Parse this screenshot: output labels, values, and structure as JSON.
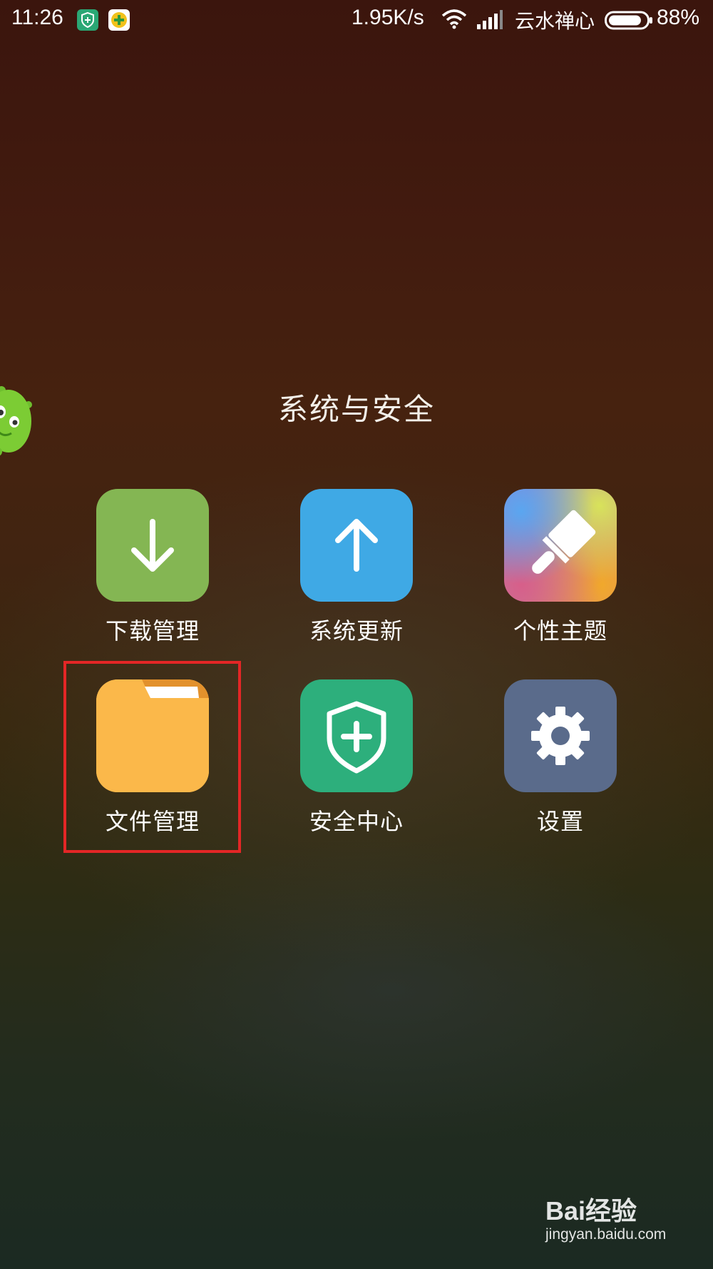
{
  "status_bar": {
    "time": "11:26",
    "notification_icons": [
      "shield-app-icon",
      "plus-app-icon"
    ],
    "network_speed": "1.95K/s",
    "carrier": "云水禅心",
    "battery_percent": "88%",
    "battery_level": 0.88
  },
  "folder": {
    "title": "系统与安全",
    "apps": [
      {
        "label": "下载管理",
        "icon": "download-arrow-icon",
        "color": "#84b653"
      },
      {
        "label": "系统更新",
        "icon": "upload-arrow-icon",
        "color": "#3fa9e5"
      },
      {
        "label": "个性主题",
        "icon": "paintbrush-icon",
        "color": "multicolor"
      },
      {
        "label": "文件管理",
        "icon": "folder-icon",
        "color": "#fbb84a",
        "highlighted": true
      },
      {
        "label": "安全中心",
        "icon": "shield-plus-icon",
        "color": "#2daf7c"
      },
      {
        "label": "设置",
        "icon": "gear-icon",
        "color": "#5a6b8b"
      }
    ]
  },
  "highlight": {
    "color": "#e42626"
  },
  "watermark": {
    "logo_text": "Bai经验",
    "url": "jingyan.baidu.com"
  }
}
